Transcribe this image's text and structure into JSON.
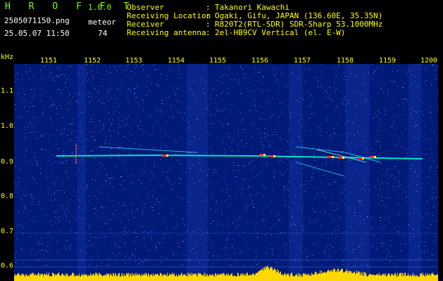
{
  "header": {
    "brand": "H R O F F T",
    "version": "1.0.0",
    "filename": "2505071150.png",
    "datetime": "25.05.07 11:50",
    "meteor_label": "meteor",
    "meteor_count": "74",
    "info_lines": [
      {
        "key": "Observer",
        "sep": ":",
        "value": "Takanori Kawachi"
      },
      {
        "key": "Receiving Location",
        "sep": ":",
        "value": "Ogaki, Gifu, JAPAN (136.60E, 35.35N)"
      },
      {
        "key": "Receiver",
        "sep": ":",
        "value": "R820T2(RTL-SDR) SDR-Sharp 53.1000MHz"
      },
      {
        "key": "Receiving antenna",
        "sep": ":",
        "value": "2el-HB9CV Vertical (el. E-W)"
      }
    ]
  },
  "axes": {
    "y_unit": "kHz",
    "x_ticks": [
      "1151",
      "1152",
      "1153",
      "1154",
      "1155",
      "1156",
      "1157",
      "1158",
      "1159",
      "1200"
    ],
    "y_ticks": [
      "1.1",
      "1.0",
      "0.9",
      "0.8",
      "0.7",
      "0.6"
    ]
  },
  "colors": {
    "background": "#001a78",
    "label": "#FFFF00",
    "brand": "#7CFC00",
    "trace": "#00ffcc",
    "hot": "#ff3030"
  }
}
